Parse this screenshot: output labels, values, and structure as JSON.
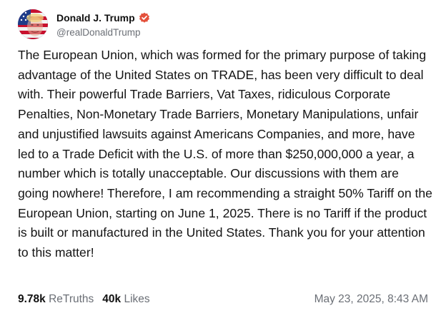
{
  "author": {
    "display_name": "Donald J. Trump",
    "handle": "@realDonaldTrump",
    "verified": true,
    "verified_color": "#e4513c"
  },
  "post": {
    "text": "The European Union, which was formed for the primary purpose of taking advantage of the United States on TRADE, has been very difficult to deal with. Their powerful Trade Barriers, Vat Taxes, ridiculous Corporate Penalties, Non-Monetary Trade Barriers, Monetary Manipulations, unfair and unjustified lawsuits against Americans Companies, and more, have led to a Trade Deficit with the U.S. of more than $250,000,000 a year, a number which is totally unacceptable. Our discussions with them are going nowhere! Therefore, I am recommending a straight 50% Tariff on the European Union, starting on June 1, 2025. There is no Tariff if the product is built or manufactured in the United States. Thank you for your attention to this matter!"
  },
  "stats": {
    "retruths_count": "9.78k",
    "retruths_label": "ReTruths",
    "likes_count": "40k",
    "likes_label": "Likes"
  },
  "timestamp": "May 23, 2025, 8:43 AM",
  "icons": {
    "avatar": "profile-photo-avatar",
    "verified": "verified-badge-icon"
  }
}
